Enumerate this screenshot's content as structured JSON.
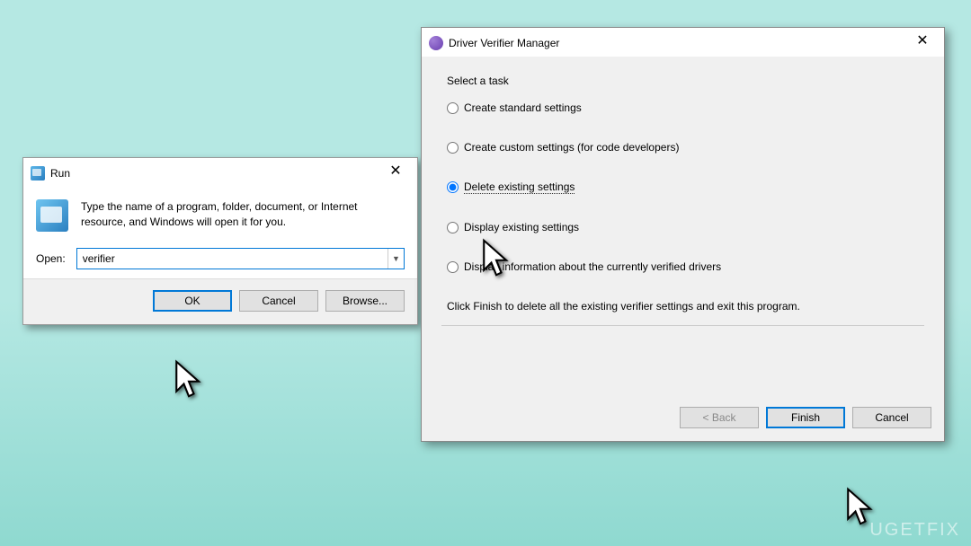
{
  "run": {
    "title": "Run",
    "message": "Type the name of a program, folder, document, or Internet resource, and Windows will open it for you.",
    "open_label": "Open:",
    "input_value": "verifier",
    "ok": "OK",
    "cancel": "Cancel",
    "browse": "Browse..."
  },
  "verifier": {
    "title": "Driver Verifier Manager",
    "select_task": "Select a task",
    "options": {
      "standard": "Create standard settings",
      "custom": "Create custom settings (for code developers)",
      "delete": "Delete existing settings",
      "display": "Display existing settings",
      "info": "Display information about the currently verified drivers"
    },
    "hint": "Click Finish to delete all the existing verifier settings and exit this program.",
    "back": "< Back",
    "finish": "Finish",
    "cancel": "Cancel"
  },
  "watermark": "UGETFIX"
}
